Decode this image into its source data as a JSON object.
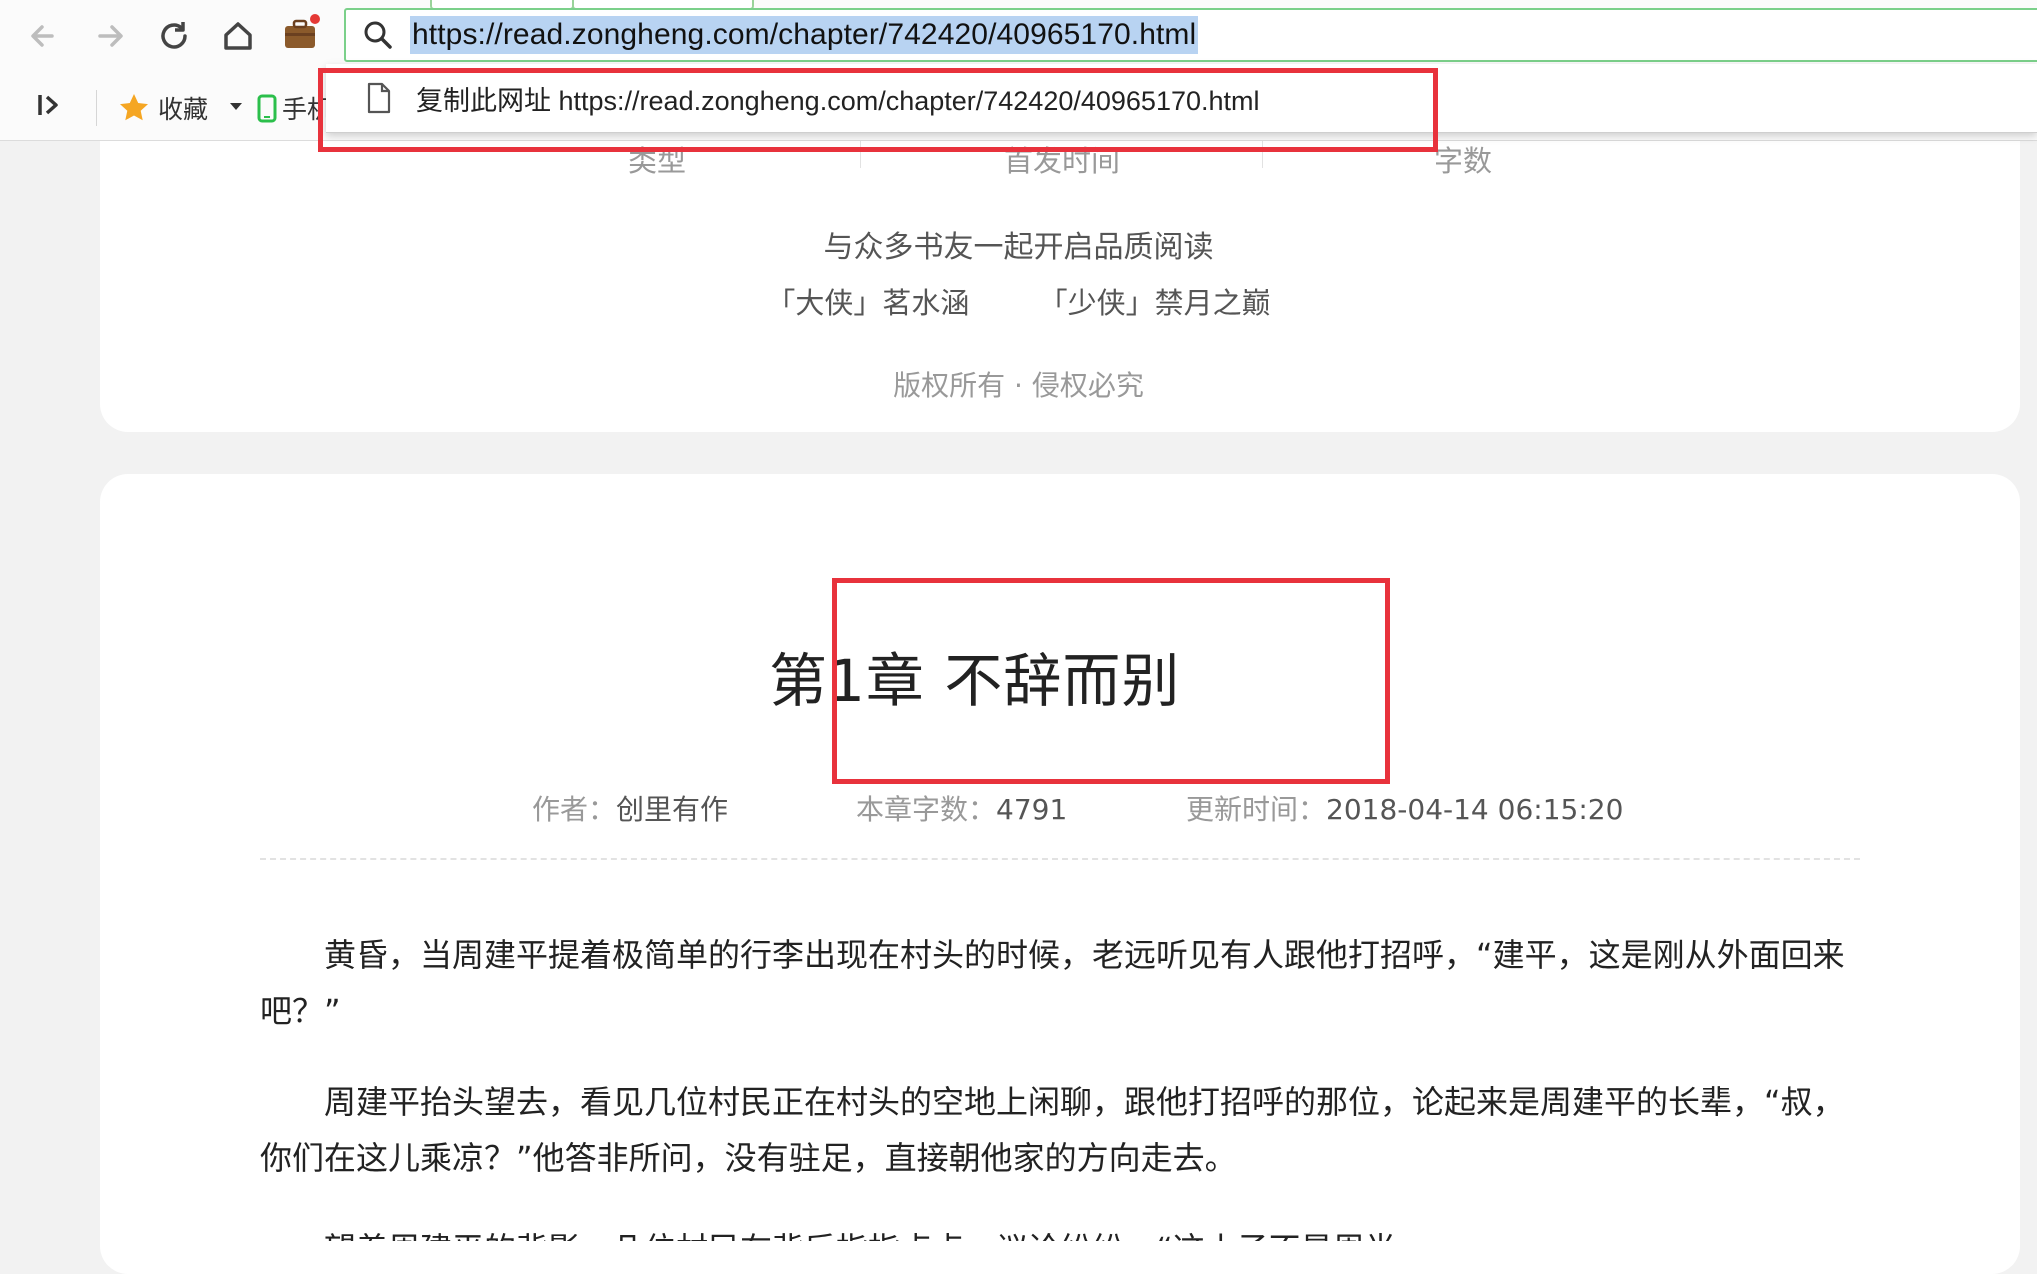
{
  "browser": {
    "address_url": "https://read.zongheng.com/chapter/742420/40965170.html",
    "bookmarks": {
      "favorites_label": "收藏",
      "phone_label": "手机"
    },
    "dropdown": {
      "copy_label": "复制此网址 https://read.zongheng.com/chapter/742420/40965170.html"
    },
    "colors": {
      "highlight": "#e8323c",
      "selection": "#b8d3f2",
      "star": "#f5a623",
      "phone": "#2bbf4b"
    }
  },
  "book_card": {
    "meta_headers": [
      "类型",
      "首发时间",
      "字数"
    ],
    "slogan": "与众多书友一起开启品质阅读",
    "author_titles": [
      "「大侠」茗水涵",
      "「少侠」禁月之巅"
    ],
    "copyright": "版权所有 · 侵权必究"
  },
  "chapter": {
    "title": "第1章 不辞而别",
    "author_label": "作者：",
    "author": "创里有作",
    "wordcount_label": "本章字数：",
    "wordcount": "4791",
    "updated_label": "更新时间：",
    "updated": "2018-04-14 06:15:20",
    "paragraphs": [
      "黄昏，当周建平提着极简单的行李出现在村头的时候，老远听见有人跟他打招呼，“建平，这是刚从外面回来吧？”",
      "周建平抬头望去，看见几位村民正在村头的空地上闲聊，跟他打招呼的那位，论起来是周建平的长辈，“叔，你们在这儿乘凉？”他答非所问，没有驻足，直接朝他家的方向走去。",
      "望着周建平的背影，几位村民在背后指指点点，议论纷纷。“这小子不是周半"
    ]
  }
}
